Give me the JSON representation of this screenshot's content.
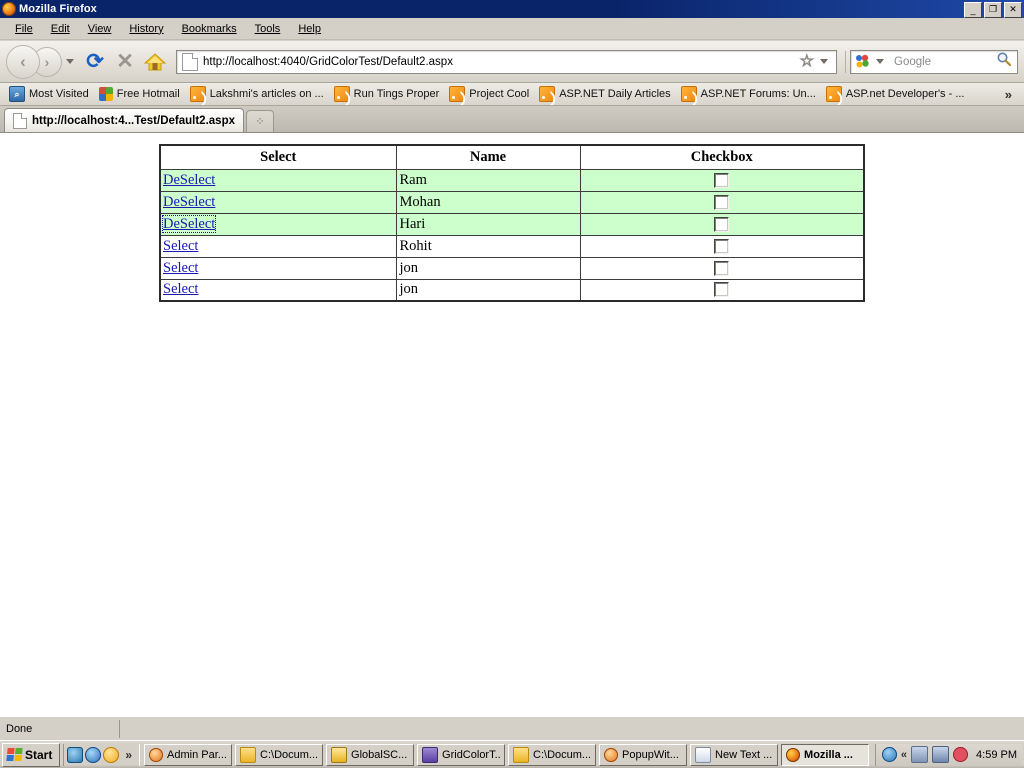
{
  "window": {
    "title": "Mozilla Firefox",
    "app_icon": "firefox-icon",
    "buttons": {
      "minimize": "_",
      "restore": "❐",
      "close": "✕"
    }
  },
  "menubar": {
    "items": [
      {
        "label": "File"
      },
      {
        "label": "Edit"
      },
      {
        "label": "View"
      },
      {
        "label": "History"
      },
      {
        "label": "Bookmarks"
      },
      {
        "label": "Tools"
      },
      {
        "label": "Help"
      }
    ]
  },
  "navbar": {
    "back_glyph": "‹",
    "forward_glyph": "›",
    "reload_glyph": "⟳",
    "stop_glyph": "✕",
    "home_glyph": "⌂",
    "url": "http://localhost:4040/GridColorTest/Default2.aspx",
    "star_glyph": "☆",
    "search_placeholder": "Google",
    "search_value": "",
    "search_engine": "Google",
    "magnifier_glyph": "🔍"
  },
  "bookmarks": {
    "items": [
      {
        "label": "Most Visited",
        "icon": "most-visited-icon"
      },
      {
        "label": "Free Hotmail",
        "icon": "hotmail-icon"
      },
      {
        "label": "Lakshmi's articles on ...",
        "icon": "rss-feed-icon"
      },
      {
        "label": "Run Tings Proper",
        "icon": "rss-feed-icon"
      },
      {
        "label": "Project Cool",
        "icon": "rss-feed-icon"
      },
      {
        "label": "ASP.NET Daily Articles",
        "icon": "rss-feed-icon"
      },
      {
        "label": "ASP.NET Forums: Un...",
        "icon": "rss-feed-icon"
      },
      {
        "label": "ASP.net Developer's - ...",
        "icon": "rss-feed-icon"
      }
    ],
    "overflow_glyph": "»"
  },
  "tabs": {
    "items": [
      {
        "label": "http://localhost:4...Test/Default2.aspx",
        "active": true
      }
    ],
    "newtab_glyph": "⁘"
  },
  "page": {
    "table": {
      "headers": [
        "Select",
        "Name",
        "Checkbox"
      ],
      "rows": [
        {
          "link": "DeSelect",
          "name": "Ram",
          "selected": true,
          "checked": false,
          "focused": false
        },
        {
          "link": "DeSelect",
          "name": "Mohan",
          "selected": true,
          "checked": false,
          "focused": false
        },
        {
          "link": "DeSelect",
          "name": "Hari",
          "selected": true,
          "checked": false,
          "focused": true
        },
        {
          "link": "Select",
          "name": "Rohit",
          "selected": false,
          "checked": false,
          "focused": false
        },
        {
          "link": "Select",
          "name": "jon",
          "selected": false,
          "checked": false,
          "focused": false
        },
        {
          "link": "Select",
          "name": "jon",
          "selected": false,
          "checked": false,
          "focused": false
        }
      ],
      "selected_row_color": "#ccffcc",
      "link_color": "#1919b3"
    }
  },
  "statusbar": {
    "text": "Done"
  },
  "taskbar": {
    "start_label": "Start",
    "quicklaunch": [
      {
        "name": "show-desktop-icon"
      },
      {
        "name": "internet-explorer-icon"
      },
      {
        "name": "media-player-icon"
      }
    ],
    "quicklaunch_overflow": "»",
    "buttons": [
      {
        "label": "Admin Par...",
        "icon": "admin-icon",
        "active": false
      },
      {
        "label": "C:\\Docum...",
        "icon": "folder-icon",
        "active": false
      },
      {
        "label": "GlobalSC...",
        "icon": "app-icon",
        "active": false
      },
      {
        "label": "GridColorT...",
        "icon": "vs-icon",
        "active": false
      },
      {
        "label": "C:\\Docum...",
        "icon": "folder-icon",
        "active": false
      },
      {
        "label": "PopupWit...",
        "icon": "popup-icon",
        "active": false
      },
      {
        "label": "New Text ...",
        "icon": "notepad-icon",
        "active": false
      },
      {
        "label": "Mozilla ...",
        "icon": "firefox-icon",
        "active": true
      }
    ],
    "tray": {
      "chevron": "«",
      "icons": [
        "help-icon",
        "network-icon",
        "network-icon",
        "antivirus-icon"
      ],
      "clock": "4:59 PM"
    }
  }
}
